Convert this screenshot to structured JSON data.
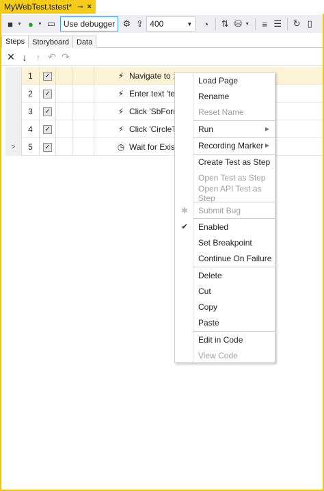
{
  "document_tab": {
    "title": "MyWebTest.tstest*",
    "pin_icon": "pin-icon",
    "close_icon": "close-icon"
  },
  "toolbar": {
    "debugger_label": "Use debugger",
    "browser_size": "400"
  },
  "subtabs": [
    "Steps",
    "Storyboard",
    "Data"
  ],
  "steps": [
    {
      "num": "1",
      "icon": "⚡",
      "desc": "Navigate to : 'h",
      "selected": true,
      "arrow": ""
    },
    {
      "num": "2",
      "icon": "⚡",
      "desc": "Enter text 'test",
      "selected": false,
      "arrow": ""
    },
    {
      "num": "3",
      "icon": "⚡",
      "desc": "Click 'SbForm(",
      "selected": false,
      "arrow": ""
    },
    {
      "num": "4",
      "icon": "⚡",
      "desc": "Click 'CircleTa",
      "selected": false,
      "arrow": ""
    },
    {
      "num": "5",
      "icon": "◷",
      "desc": "Wait for Exists",
      "selected": false,
      "arrow": ">"
    }
  ],
  "context_menu": {
    "items": [
      {
        "label": "Load Page",
        "disabled": false
      },
      {
        "label": "Rename",
        "disabled": false
      },
      {
        "label": "Reset Name",
        "disabled": true
      },
      {
        "label": "Run",
        "disabled": false,
        "submenu": true
      },
      {
        "label": "Recording Marker",
        "disabled": false,
        "submenu": true
      },
      {
        "label": "Create Test as Step",
        "disabled": false
      },
      {
        "label": "Open Test as Step",
        "disabled": true
      },
      {
        "label": "Open API Test as Step",
        "disabled": true
      },
      {
        "label": "Submit Bug",
        "disabled": true,
        "icon": "bug-icon"
      },
      {
        "label": "Enabled",
        "disabled": false,
        "checked": true
      },
      {
        "label": "Set Breakpoint",
        "disabled": false
      },
      {
        "label": "Continue On Failure",
        "disabled": false
      },
      {
        "label": "Delete",
        "disabled": false
      },
      {
        "label": "Cut",
        "disabled": false
      },
      {
        "label": "Copy",
        "disabled": false
      },
      {
        "label": "Paste",
        "disabled": false
      },
      {
        "label": "Edit in Code",
        "disabled": false
      },
      {
        "label": "View Code",
        "disabled": true
      }
    ]
  },
  "colors": {
    "accent": "#f2c40f",
    "selected_row": "#fdf3d7",
    "debugger_border": "#3399ff"
  }
}
